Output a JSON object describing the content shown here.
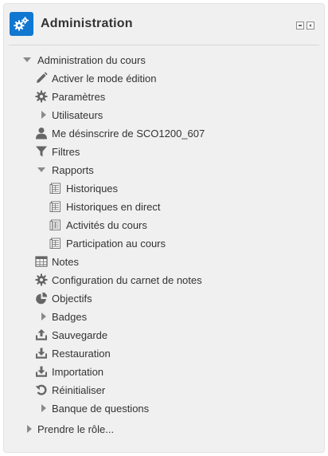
{
  "block": {
    "title": "Administration",
    "icon": "gears-icon",
    "controls": [
      "hide-block-icon",
      "dock-block-icon"
    ]
  },
  "tree": {
    "course_admin": "Administration du cours",
    "items": [
      {
        "label": "Activer le mode édition",
        "icon": "pencil-icon"
      },
      {
        "label": "Paramètres",
        "icon": "gear-icon"
      },
      {
        "label": "Utilisateurs",
        "icon": "triangle-right-icon"
      },
      {
        "label": "Me désinscrire de SCO1200_607",
        "icon": "user-icon"
      },
      {
        "label": "Filtres",
        "icon": "filter-icon"
      },
      {
        "label": "Rapports",
        "icon": "triangle-down-icon"
      }
    ],
    "reports": [
      {
        "label": "Historiques",
        "icon": "report-icon"
      },
      {
        "label": "Historiques en direct",
        "icon": "report-icon"
      },
      {
        "label": "Activités du cours",
        "icon": "report-icon"
      },
      {
        "label": "Participation au cours",
        "icon": "report-icon"
      }
    ],
    "items_after": [
      {
        "label": "Notes",
        "icon": "grades-table-icon"
      },
      {
        "label": "Configuration du carnet de notes",
        "icon": "gear-icon"
      },
      {
        "label": "Objectifs",
        "icon": "outcomes-icon"
      },
      {
        "label": "Badges",
        "icon": "triangle-right-icon"
      },
      {
        "label": "Sauvegarde",
        "icon": "backup-icon"
      },
      {
        "label": "Restauration",
        "icon": "restore-icon"
      },
      {
        "label": "Importation",
        "icon": "import-icon"
      },
      {
        "label": "Réinitialiser",
        "icon": "reset-icon"
      },
      {
        "label": "Banque de questions",
        "icon": "triangle-right-icon"
      }
    ],
    "switch_role": "Prendre le rôle..."
  }
}
